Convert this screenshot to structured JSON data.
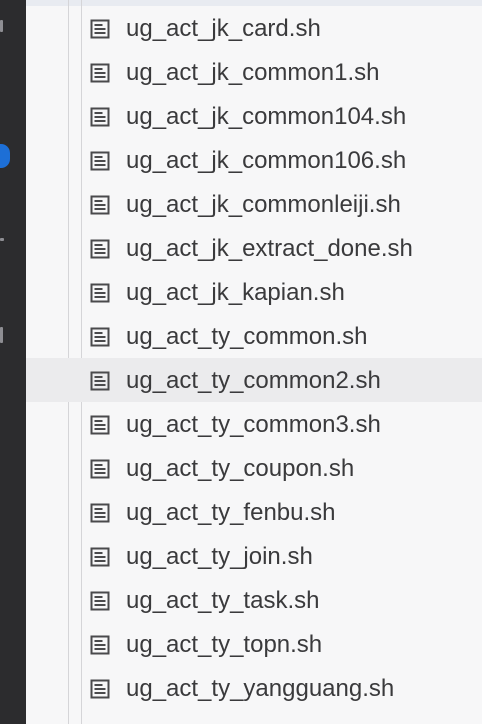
{
  "explorer": {
    "files": [
      {
        "name": "ug_act_jk_card.sh",
        "icon": "file-text-icon"
      },
      {
        "name": "ug_act_jk_common1.sh",
        "icon": "file-text-icon"
      },
      {
        "name": "ug_act_jk_common104.sh",
        "icon": "file-text-icon"
      },
      {
        "name": "ug_act_jk_common106.sh",
        "icon": "file-text-icon"
      },
      {
        "name": "ug_act_jk_commonleiji.sh",
        "icon": "file-text-icon"
      },
      {
        "name": "ug_act_jk_extract_done.sh",
        "icon": "file-text-icon"
      },
      {
        "name": "ug_act_jk_kapian.sh",
        "icon": "file-text-icon"
      },
      {
        "name": "ug_act_ty_common.sh",
        "icon": "file-text-icon"
      },
      {
        "name": "ug_act_ty_common2.sh",
        "icon": "file-text-icon"
      },
      {
        "name": "ug_act_ty_common3.sh",
        "icon": "file-text-icon"
      },
      {
        "name": "ug_act_ty_coupon.sh",
        "icon": "file-text-icon"
      },
      {
        "name": "ug_act_ty_fenbu.sh",
        "icon": "file-text-icon"
      },
      {
        "name": "ug_act_ty_join.sh",
        "icon": "file-text-icon"
      },
      {
        "name": "ug_act_ty_task.sh",
        "icon": "file-text-icon"
      },
      {
        "name": "ug_act_ty_topn.sh",
        "icon": "file-text-icon"
      },
      {
        "name": "ug_act_ty_yangguang.sh",
        "icon": "file-text-icon"
      }
    ],
    "hovered_file": "ug_act_ty_common2.sh"
  },
  "colors": {
    "activity_bar": "#2c2c2e",
    "badge": "#1d6fd6",
    "explorer_bg": "#f7f7f8",
    "hover_row": "#ebebed",
    "file_text": "#3a3a3c",
    "icon": "#4a4a4c"
  }
}
